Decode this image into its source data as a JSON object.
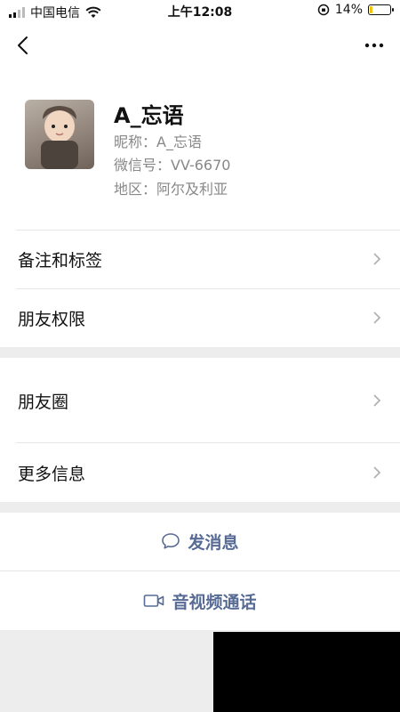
{
  "status_bar": {
    "carrier": "中国电信",
    "time": "上午12:08",
    "battery_percent": "14%",
    "battery_level": 0.14
  },
  "profile": {
    "display_name": "A_忘语",
    "nickname": "昵称：A_忘语",
    "wechat_id": "微信号：VV-6670",
    "region": "地区：阿尔及利亚"
  },
  "menu": [
    {
      "label": "备注和标签"
    },
    {
      "label": "朋友权限"
    },
    {
      "label": "朋友圈"
    },
    {
      "label": "更多信息"
    }
  ],
  "actions": {
    "message": "发消息",
    "call": "音视频通话"
  },
  "colors": {
    "link": "#576b95",
    "band": "#ededed",
    "battery": "#f2c200"
  }
}
